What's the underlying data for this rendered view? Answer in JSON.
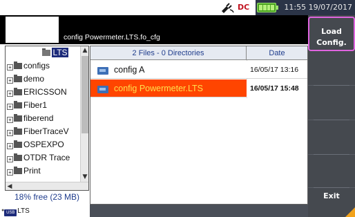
{
  "status": {
    "time_date": "11:55 19/07/2017",
    "dc_label": "DC"
  },
  "header": {
    "current_path": "config Powermeter.LTS.fo_cfg"
  },
  "tree": {
    "root": "LTS",
    "items": [
      "configs",
      "demo",
      "ERICSSON",
      "Fiber1",
      "fiberend",
      "FiberTraceV",
      "OSPEXPO",
      "OTDR Trace",
      "Print"
    ]
  },
  "storage": {
    "free_space": "18% free (23 MB)",
    "drive_label": "LTS",
    "usb_badge": "USB"
  },
  "files": {
    "header_count": "2 Files - 0 Directories",
    "header_date": "Date",
    "rows": [
      {
        "name": "config A",
        "date": "16/05/17 13:16",
        "selected": false
      },
      {
        "name": "config Powermeter.LTS",
        "date": "16/05/17 15:48",
        "selected": true
      }
    ]
  },
  "side_buttons": {
    "load_line1": "Load",
    "load_line2": "Config.",
    "exit": "Exit"
  },
  "colors": {
    "selection": "#ff4500",
    "selected_text": "#ffe14d",
    "panel": "#45494f",
    "highlight_border": "#e064e0"
  }
}
